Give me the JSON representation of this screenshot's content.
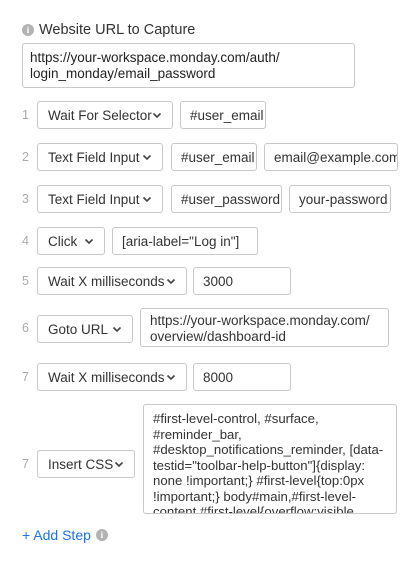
{
  "header": {
    "label": "Website URL to Capture",
    "info_icon": "i"
  },
  "url_field": {
    "value": "https://your-workspace.monday.com/auth/\nlogin_monday/email_password"
  },
  "chevron_icon": "chevron-down-icon",
  "steps": [
    {
      "num": "1",
      "action": "Wait For Selector",
      "fields": [
        "#user_email"
      ]
    },
    {
      "num": "2",
      "action": "Text Field Input",
      "fields": [
        "#user_email",
        "email@example.com"
      ]
    },
    {
      "num": "3",
      "action": "Text Field Input",
      "fields": [
        "#user_password",
        "your-password"
      ]
    },
    {
      "num": "4",
      "action": "Click",
      "fields": [
        "[aria-label=\"Log in\"]"
      ]
    },
    {
      "num": "5",
      "action": "Wait X milliseconds",
      "fields": [
        "3000"
      ]
    },
    {
      "num": "6",
      "action": "Goto URL",
      "fields": [
        "https://your-workspace.monday.com/\noverview/dashboard-id"
      ]
    },
    {
      "num": "7",
      "action": "Wait X milliseconds",
      "fields": [
        "8000"
      ]
    },
    {
      "num": "7",
      "action": "Insert CSS",
      "fields": [
        "#first-level-control, #surface, #reminder_bar, #desktop_notifications_reminder, [data-testid=\"toolbar-help-button\"]{display: none !important;} #first-level{top:0px !important;} body#main,#first-level-content,#first-level{overflow:visible !important;}"
      ]
    }
  ],
  "add_step": {
    "label": "+ Add Step",
    "info_icon": "i"
  },
  "colors": {
    "accent": "#1a73e8",
    "border": "#c9c9c9",
    "muted": "#aaaaaa"
  }
}
